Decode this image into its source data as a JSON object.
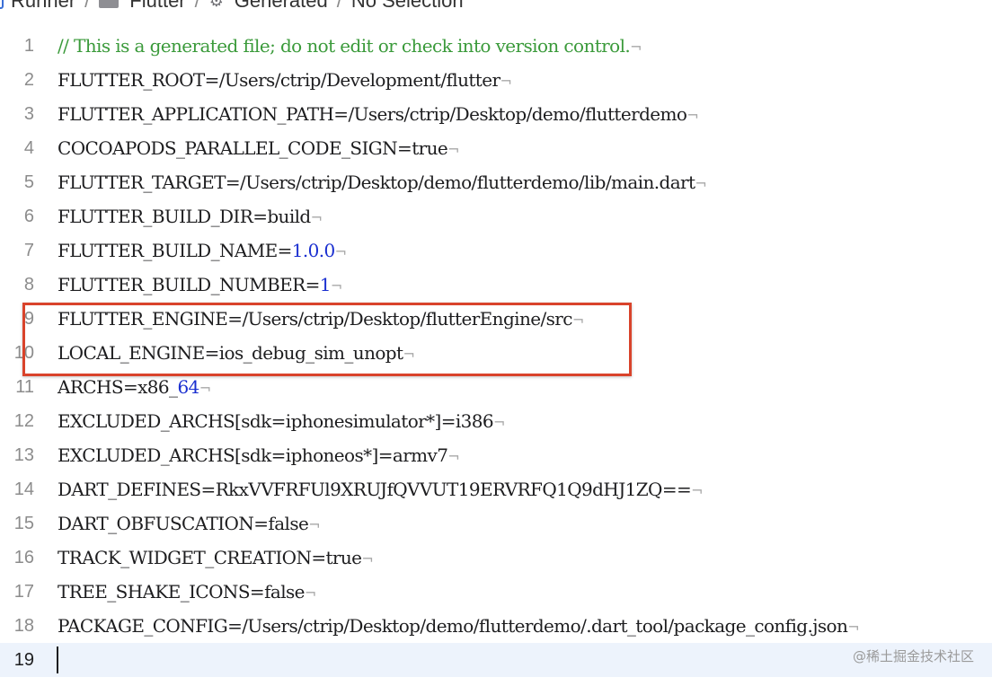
{
  "breadcrumb": {
    "items": [
      "Runner",
      "Flutter",
      "Generated",
      "No Selection"
    ],
    "separator": "/"
  },
  "editor": {
    "current_line": 19,
    "lines": [
      {
        "num": "1",
        "segments": [
          {
            "t": "// This is a generated file; do not edit or check into version control.",
            "k": "comment"
          }
        ]
      },
      {
        "num": "2",
        "segments": [
          {
            "t": "FLUTTER_ROOT=/Users/ctrip/Development/flutter",
            "k": "plain"
          }
        ]
      },
      {
        "num": "3",
        "segments": [
          {
            "t": "FLUTTER_APPLICATION_PATH=/Users/ctrip/Desktop/demo/flutterdemo",
            "k": "plain"
          }
        ]
      },
      {
        "num": "4",
        "segments": [
          {
            "t": "COCOAPODS_PARALLEL_CODE_SIGN=true",
            "k": "plain"
          }
        ]
      },
      {
        "num": "5",
        "segments": [
          {
            "t": "FLUTTER_TARGET=/Users/ctrip/Desktop/demo/flutterdemo/lib/main.dart",
            "k": "plain"
          }
        ]
      },
      {
        "num": "6",
        "segments": [
          {
            "t": "FLUTTER_BUILD_DIR=build",
            "k": "plain"
          }
        ]
      },
      {
        "num": "7",
        "segments": [
          {
            "t": "FLUTTER_BUILD_NAME=",
            "k": "plain"
          },
          {
            "t": "1.0.0",
            "k": "num"
          }
        ]
      },
      {
        "num": "8",
        "segments": [
          {
            "t": "FLUTTER_BUILD_NUMBER=",
            "k": "plain"
          },
          {
            "t": "1",
            "k": "num"
          }
        ]
      },
      {
        "num": "9",
        "segments": [
          {
            "t": "FLUTTER_ENGINE=/Users/ctrip/Desktop/flutterEngine/src",
            "k": "plain"
          }
        ]
      },
      {
        "num": "10",
        "segments": [
          {
            "t": "LOCAL_ENGINE=ios_debug_sim_unopt",
            "k": "plain"
          }
        ]
      },
      {
        "num": "11",
        "segments": [
          {
            "t": "ARCHS=x86_",
            "k": "plain"
          },
          {
            "t": "64",
            "k": "num"
          }
        ]
      },
      {
        "num": "12",
        "segments": [
          {
            "t": "EXCLUDED_ARCHS[sdk=iphonesimulator*]=i386",
            "k": "plain"
          }
        ]
      },
      {
        "num": "13",
        "segments": [
          {
            "t": "EXCLUDED_ARCHS[sdk=iphoneos*]=armv7",
            "k": "plain"
          }
        ]
      },
      {
        "num": "14",
        "segments": [
          {
            "t": "DART_DEFINES=RkxVVFRFUl9XRUJfQVVUT19ERVRFQ1Q9dHJ1ZQ==",
            "k": "plain"
          }
        ]
      },
      {
        "num": "15",
        "segments": [
          {
            "t": "DART_OBFUSCATION=false",
            "k": "plain"
          }
        ]
      },
      {
        "num": "16",
        "segments": [
          {
            "t": "TRACK_WIDGET_CREATION=true",
            "k": "plain"
          }
        ]
      },
      {
        "num": "17",
        "segments": [
          {
            "t": "TREE_SHAKE_ICONS=false",
            "k": "plain"
          }
        ]
      },
      {
        "num": "18",
        "segments": [
          {
            "t": "PACKAGE_CONFIG=/Users/ctrip/Desktop/demo/flutterdemo/.dart_tool/package_config.json",
            "k": "plain"
          }
        ]
      },
      {
        "num": "19",
        "segments": []
      }
    ],
    "eol_marker": "¬"
  },
  "watermark": "@稀土掘金技术社区",
  "colors": {
    "comment": "#3a9a3a",
    "number": "#1a2fd0",
    "highlight_box": "#d9432b",
    "current_line_bg": "#edf3fc"
  }
}
